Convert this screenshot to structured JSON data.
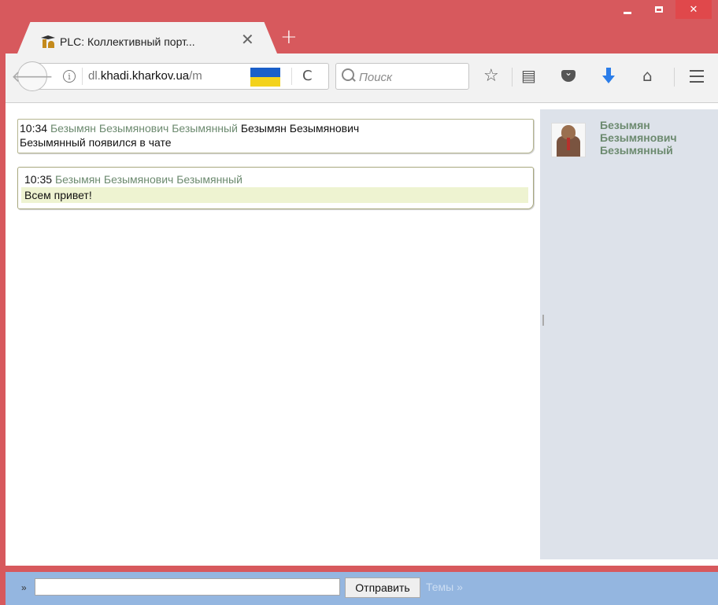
{
  "browser": {
    "tab": {
      "title": "PLC: Коллективный порт...",
      "close_glyph": "✕"
    },
    "new_tab_glyph": "+",
    "window_controls": {
      "close_glyph": "✕"
    },
    "url": {
      "prefix": "dl.",
      "domain": "khadi.kharkov.ua",
      "path": "/m"
    },
    "search": {
      "placeholder": "Поиск"
    },
    "icons": {
      "back": "arrow-left-icon",
      "info": "info-icon",
      "reload": "reload-icon",
      "bookmark": "star-icon",
      "reading_list": "clipboard-icon",
      "pocket": "pocket-icon",
      "download": "download-icon",
      "home": "home-icon",
      "menu": "hamburger-icon"
    },
    "flag_colors": [
      "#1a5fc9",
      "#f3d21c"
    ]
  },
  "chat": {
    "messages": [
      {
        "time": "10:34",
        "author": "Безымян Безымянович Безымянный",
        "text_line1": "Безымян Безымянович",
        "text_line2": "Безымянный появился в чате"
      },
      {
        "time": "10:35",
        "author": "Безымян Безымянович Безымянный",
        "text": "Всем привет!"
      }
    ],
    "sidebar": {
      "users": [
        {
          "name_line1": "Безымян",
          "name_line2": "Безымянович",
          "name_line3": "Безымянный"
        }
      ]
    },
    "bottom": {
      "prompt": "»",
      "input_value": "",
      "send_label": "Отправить",
      "topics_link": "Темы »"
    }
  },
  "colors": {
    "window_frame": "#d7595d",
    "author_name": "#6c8a6f",
    "sidebar_bg": "#dde2ea",
    "bottom_bar": "#94b6e0",
    "message_highlight": "#eef3d1"
  }
}
